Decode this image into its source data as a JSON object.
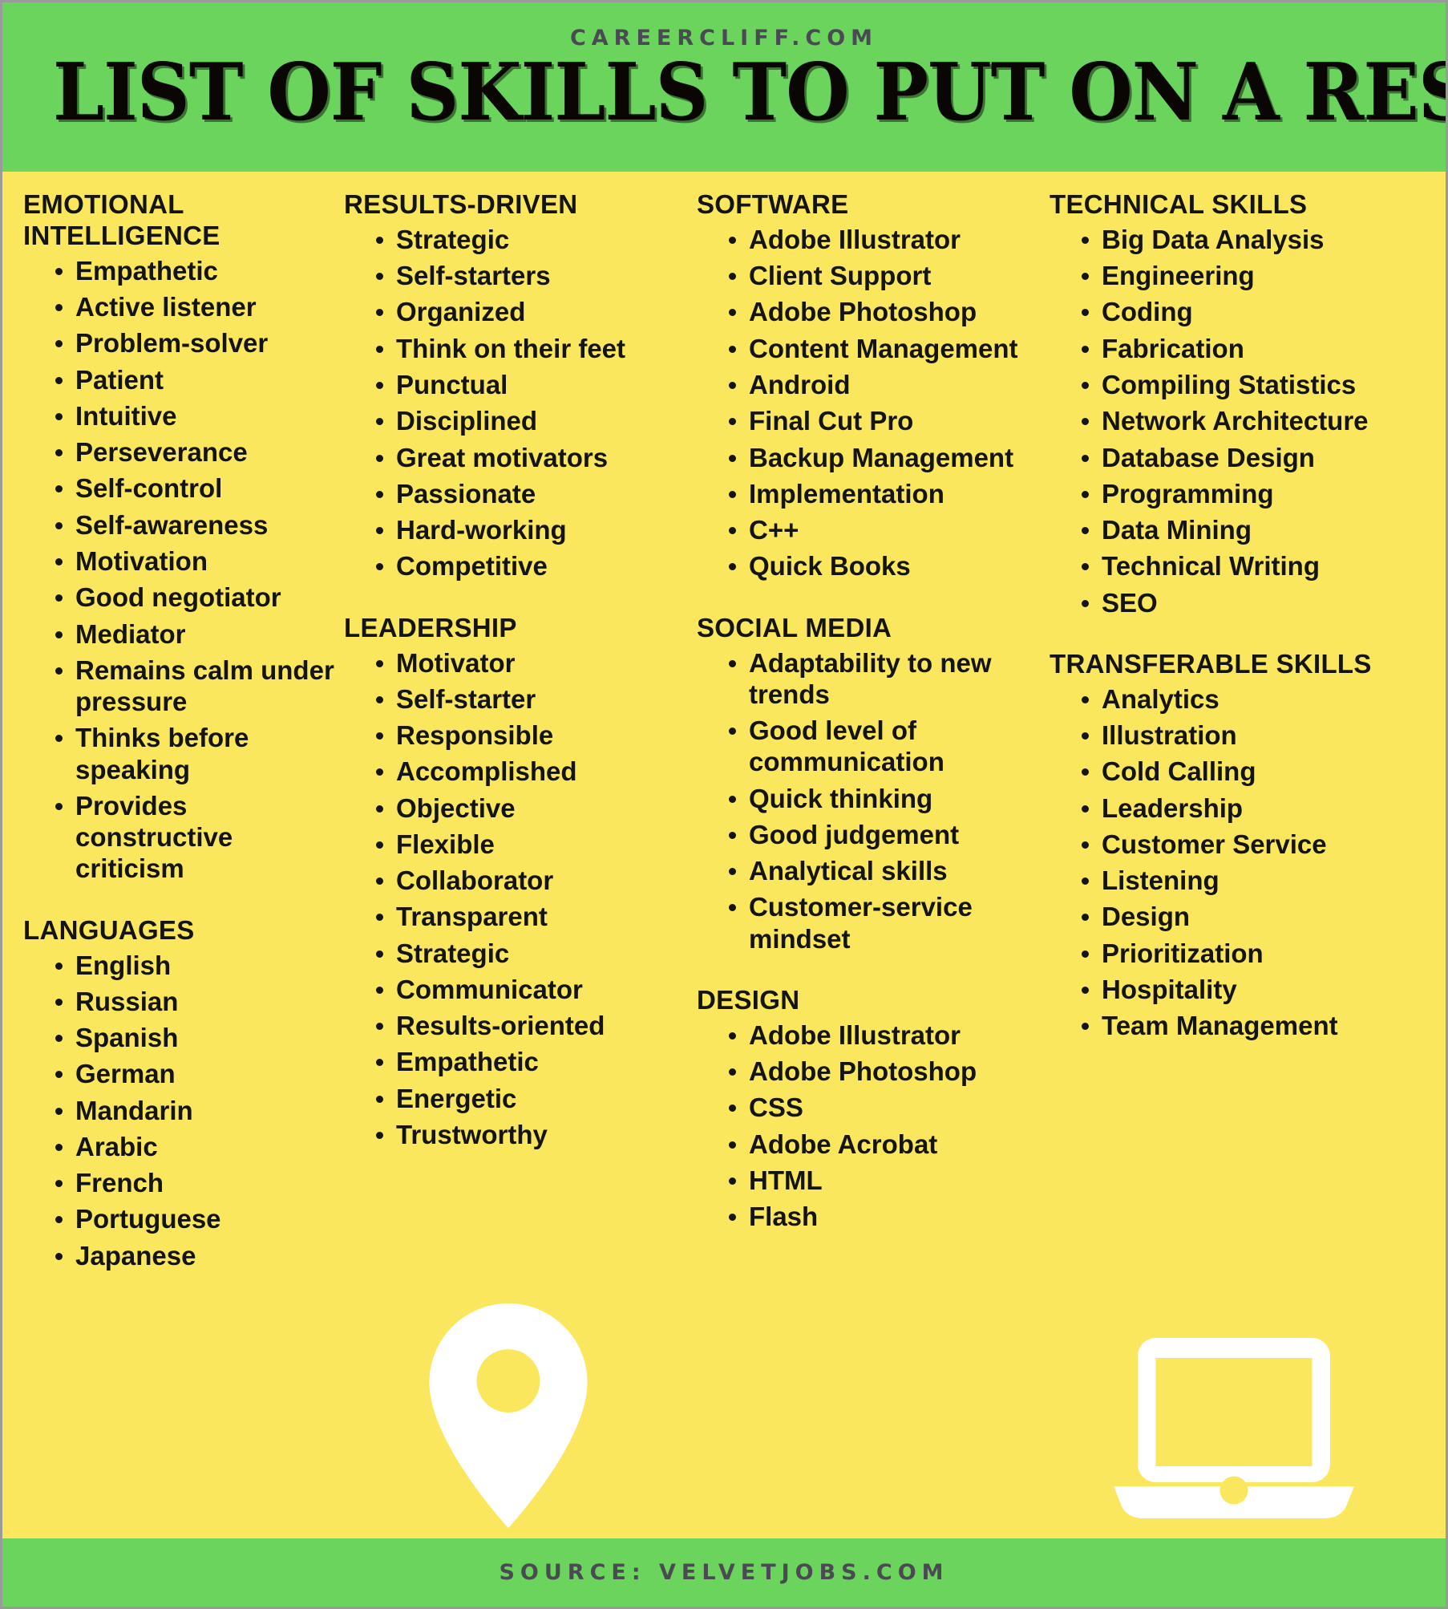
{
  "header": {
    "site": "CAREERCLIFF.COM",
    "title": "LIST OF SKILLS TO PUT ON A RESUME"
  },
  "footer": {
    "source": "SOURCE: VELVETJOBS.COM"
  },
  "colors": {
    "banner_green": "#6BD45D",
    "background_yellow": "#FBE75E",
    "text_black": "#141414",
    "site_gray": "#4A4A52",
    "icon_white": "#FFFFFF"
  },
  "icons": {
    "map_pin": "map-pin-icon",
    "laptop": "laptop-icon"
  },
  "columns": [
    {
      "sections": [
        {
          "heading": "EMOTIONAL INTELLIGENCE",
          "items": [
            "Empathetic",
            "Active listener",
            "Problem-solver",
            "Patient",
            "Intuitive",
            "Perseverance",
            "Self-control",
            "Self-awareness",
            "Motivation",
            "Good negotiator",
            "Mediator",
            "Remains calm under pressure",
            "Thinks before speaking",
            "Provides constructive criticism"
          ]
        },
        {
          "heading": "LANGUAGES",
          "items": [
            "English",
            "Russian",
            "Spanish",
            "German",
            "Mandarin",
            "Arabic",
            "French",
            "Portuguese",
            "Japanese"
          ]
        }
      ]
    },
    {
      "sections": [
        {
          "heading": "RESULTS-DRIVEN",
          "items": [
            "Strategic",
            "Self-starters",
            "Organized",
            "Think on their feet",
            "Punctual",
            "Disciplined",
            "Great motivators",
            "Passionate",
            "Hard-working",
            "Competitive"
          ]
        },
        {
          "heading": "LEADERSHIP",
          "items": [
            "Motivator",
            "Self-starter",
            "Responsible",
            "Accomplished",
            "Objective",
            "Flexible",
            "Collaborator",
            "Transparent",
            "Strategic",
            "Communicator",
            "Results-oriented",
            "Empathetic",
            "Energetic",
            "Trustworthy"
          ]
        }
      ]
    },
    {
      "sections": [
        {
          "heading": "SOFTWARE",
          "items": [
            "Adobe Illustrator",
            "Client Support",
            "Adobe Photoshop",
            "Content Management",
            "Android",
            "Final Cut Pro",
            "Backup Management",
            "Implementation",
            "C++",
            "Quick Books"
          ]
        },
        {
          "heading": "SOCIAL MEDIA",
          "items": [
            "Adaptability to new trends",
            "Good level of communication",
            "Quick thinking",
            "Good judgement",
            "Analytical skills",
            "Customer-service mindset"
          ]
        },
        {
          "heading": "DESIGN",
          "items": [
            "Adobe Illustrator",
            "Adobe Photoshop",
            "CSS",
            "Adobe Acrobat",
            "HTML",
            "Flash"
          ]
        }
      ]
    },
    {
      "sections": [
        {
          "heading": "TECHNICAL SKILLS",
          "items": [
            "Big Data Analysis",
            "Engineering",
            "Coding",
            "Fabrication",
            "Compiling Statistics",
            "Network Architecture",
            "Database Design",
            "Programming",
            "Data Mining",
            "Technical Writing",
            "SEO"
          ]
        },
        {
          "heading": "TRANSFERABLE SKILLS",
          "items": [
            "Analytics",
            "Illustration",
            "Cold Calling",
            "Leadership",
            "Customer Service",
            "Listening",
            "Design",
            "Prioritization",
            "Hospitality",
            "Team Management"
          ]
        }
      ]
    }
  ]
}
